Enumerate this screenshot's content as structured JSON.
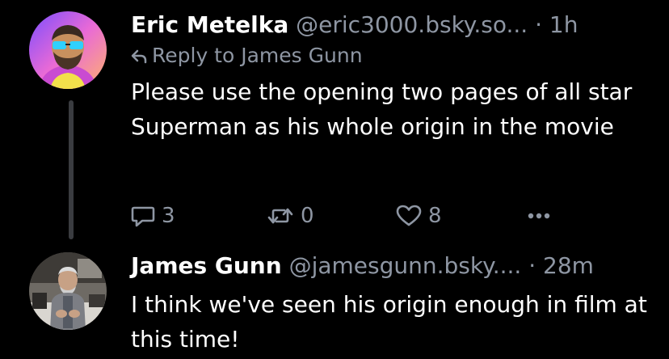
{
  "posts": [
    {
      "author_name": "Eric Metelka",
      "handle": "@eric3000.bsky.so...",
      "separator": "·",
      "time": "1h",
      "reply_label": "Reply to James Gunn",
      "text": "Please use the opening two pages of all star Superman as his whole origin in the movie",
      "counts": {
        "replies": "3",
        "reposts": "0",
        "likes": "8"
      },
      "icons": [
        "reply-arrow-icon",
        "comment-icon",
        "repost-icon",
        "heart-icon",
        "more-options-icon"
      ]
    },
    {
      "author_name": "James Gunn",
      "handle": "@jamesgunn.bsky....",
      "separator": "·",
      "time": "28m",
      "text": "I think we've seen his origin enough in film at this time!"
    }
  ],
  "colors": {
    "background": "#000000",
    "primary_text": "#ffffff",
    "secondary_text": "#8e96a3",
    "thread_line": "#3a3c40"
  }
}
